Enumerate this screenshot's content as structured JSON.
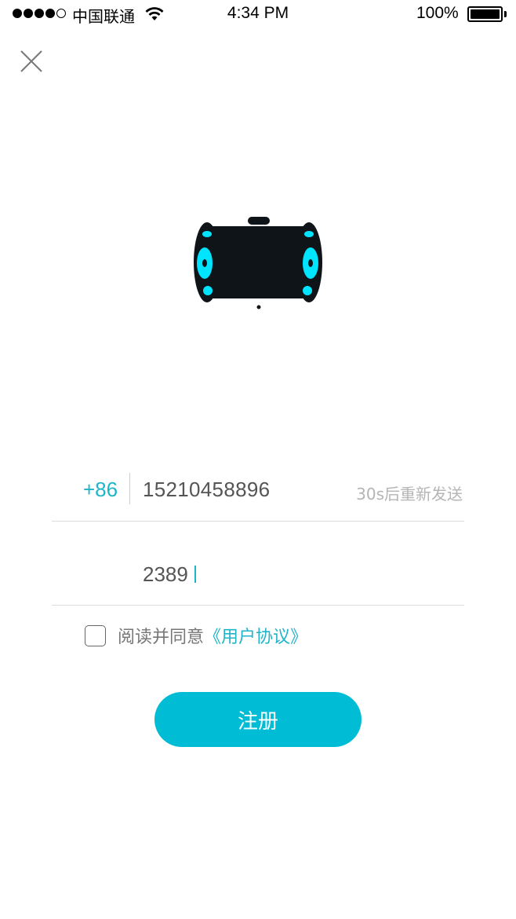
{
  "status_bar": {
    "carrier": "中国联通",
    "time": "4:34 PM",
    "battery": "100%",
    "signal_strength": "4 of 5"
  },
  "icons": {
    "close": "close-icon",
    "logo": "robot-logo"
  },
  "colors": {
    "accent": "#1fb5c9",
    "button": "#00bcd4",
    "logo_body": "#0f1419",
    "logo_light": "#00e5ff"
  },
  "form": {
    "country_code": "+86",
    "phone_value": "15210458896",
    "resend_text": "30s后重新发送",
    "code_value": "2389"
  },
  "agreement": {
    "text": "阅读并同意",
    "link": "《用户协议》",
    "checked": false
  },
  "register_button": "注册"
}
